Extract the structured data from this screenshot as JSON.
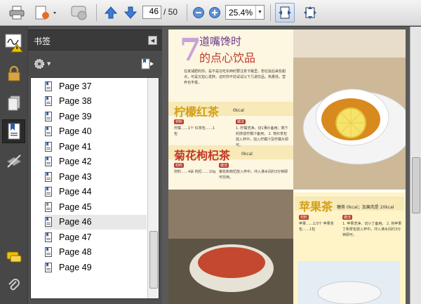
{
  "toolbar": {
    "current_page": "46",
    "total_pages": "/ 50",
    "zoom": "25.4%"
  },
  "bookmarks_panel": {
    "title": "书签",
    "items": [
      {
        "label": "Page 37"
      },
      {
        "label": "Page 38"
      },
      {
        "label": "Page 39"
      },
      {
        "label": "Page 40"
      },
      {
        "label": "Page 41"
      },
      {
        "label": "Page 42"
      },
      {
        "label": "Page 43"
      },
      {
        "label": "Page 44"
      },
      {
        "label": "Page 45"
      },
      {
        "label": "Page 46"
      },
      {
        "label": "Page 47"
      },
      {
        "label": "Page 48"
      },
      {
        "label": "Page 49"
      }
    ],
    "selected": "Page 46"
  },
  "document": {
    "number": "7",
    "title_line1": "道嘴馋时",
    "title_line2": "的点心饮品",
    "tea1": "柠檬红茶",
    "tea1_kcal": "0kcal",
    "tea2": "菊花枸杞茶",
    "tea2_kcal": "0kcal",
    "tea3": "苹果茶",
    "tea3_kcal": "糖茶 0kcal；加果肉是 20kcal",
    "tag_material": "材料",
    "tag_method": "做法",
    "intro": "在家减肥的你，是不是在吃东西时要注意卡路里，想在饭后来些甜点，可是又担心发胖。这时你不妨试试以下几道饮品，热量低，营养也丰富。",
    "tea1_ingredients": "柠檬……1个 红茶包……1包",
    "tea1_method": "1. 柠檬洗净，切1薄片备用；剩下的挤成柠檬汁备用。 2. 将红茶包放入杯中，加入柠檬汁及柠檬片即可。",
    "tea2_ingredients": "材料……4朵 枸杞……10g",
    "tea2_method": "菊花和枸杞放入杯中，冲入沸水闷约3分钟即可饮用。",
    "tea3_ingredients": "苹果……1/3个 苹果茶包……1包",
    "tea3_method": "1. 苹果洗净、切小丁备用。 2. 将苹果丁和茶包放入杯中，冲入沸水闷约3分钟即可。"
  },
  "colors": {
    "rail": "#474747",
    "panel": "#505050",
    "selected_row": "#e8e8e8",
    "tea1_title": "#d4a017",
    "tea2_title": "#c0392b",
    "tea3_title": "#d4a017"
  }
}
